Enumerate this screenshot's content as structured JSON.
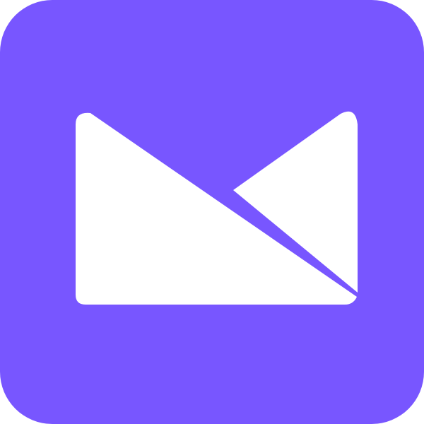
{
  "app_icon": {
    "icon": "envelope-icon",
    "background_color": "#7856FF",
    "glyph_color": "#FFFFFF"
  }
}
